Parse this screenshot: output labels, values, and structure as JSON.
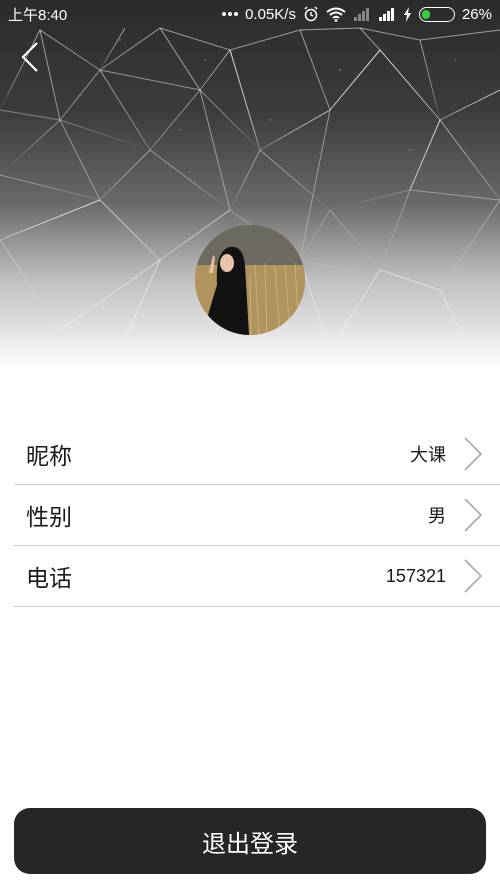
{
  "status_bar": {
    "time": "上午8:40",
    "network_speed": "0.05K/s",
    "battery_percent": "26%",
    "battery_level": 0.26,
    "icons": [
      "alarm-icon",
      "wifi-icon",
      "signal-weak-icon",
      "signal-icon",
      "charging-icon",
      "battery-icon"
    ]
  },
  "header": {
    "back_icon": "chevron-left-icon",
    "avatar": "profile-photo"
  },
  "profile": {
    "rows": [
      {
        "label": "昵称",
        "value": "大课"
      },
      {
        "label": "性别",
        "value": "男"
      },
      {
        "label": "电话",
        "value": "157321"
      }
    ]
  },
  "actions": {
    "logout_label": "退出登录"
  },
  "colors": {
    "button_bg": "#262626",
    "divider": "#cfcfcf",
    "battery_fill": "#31d041"
  }
}
